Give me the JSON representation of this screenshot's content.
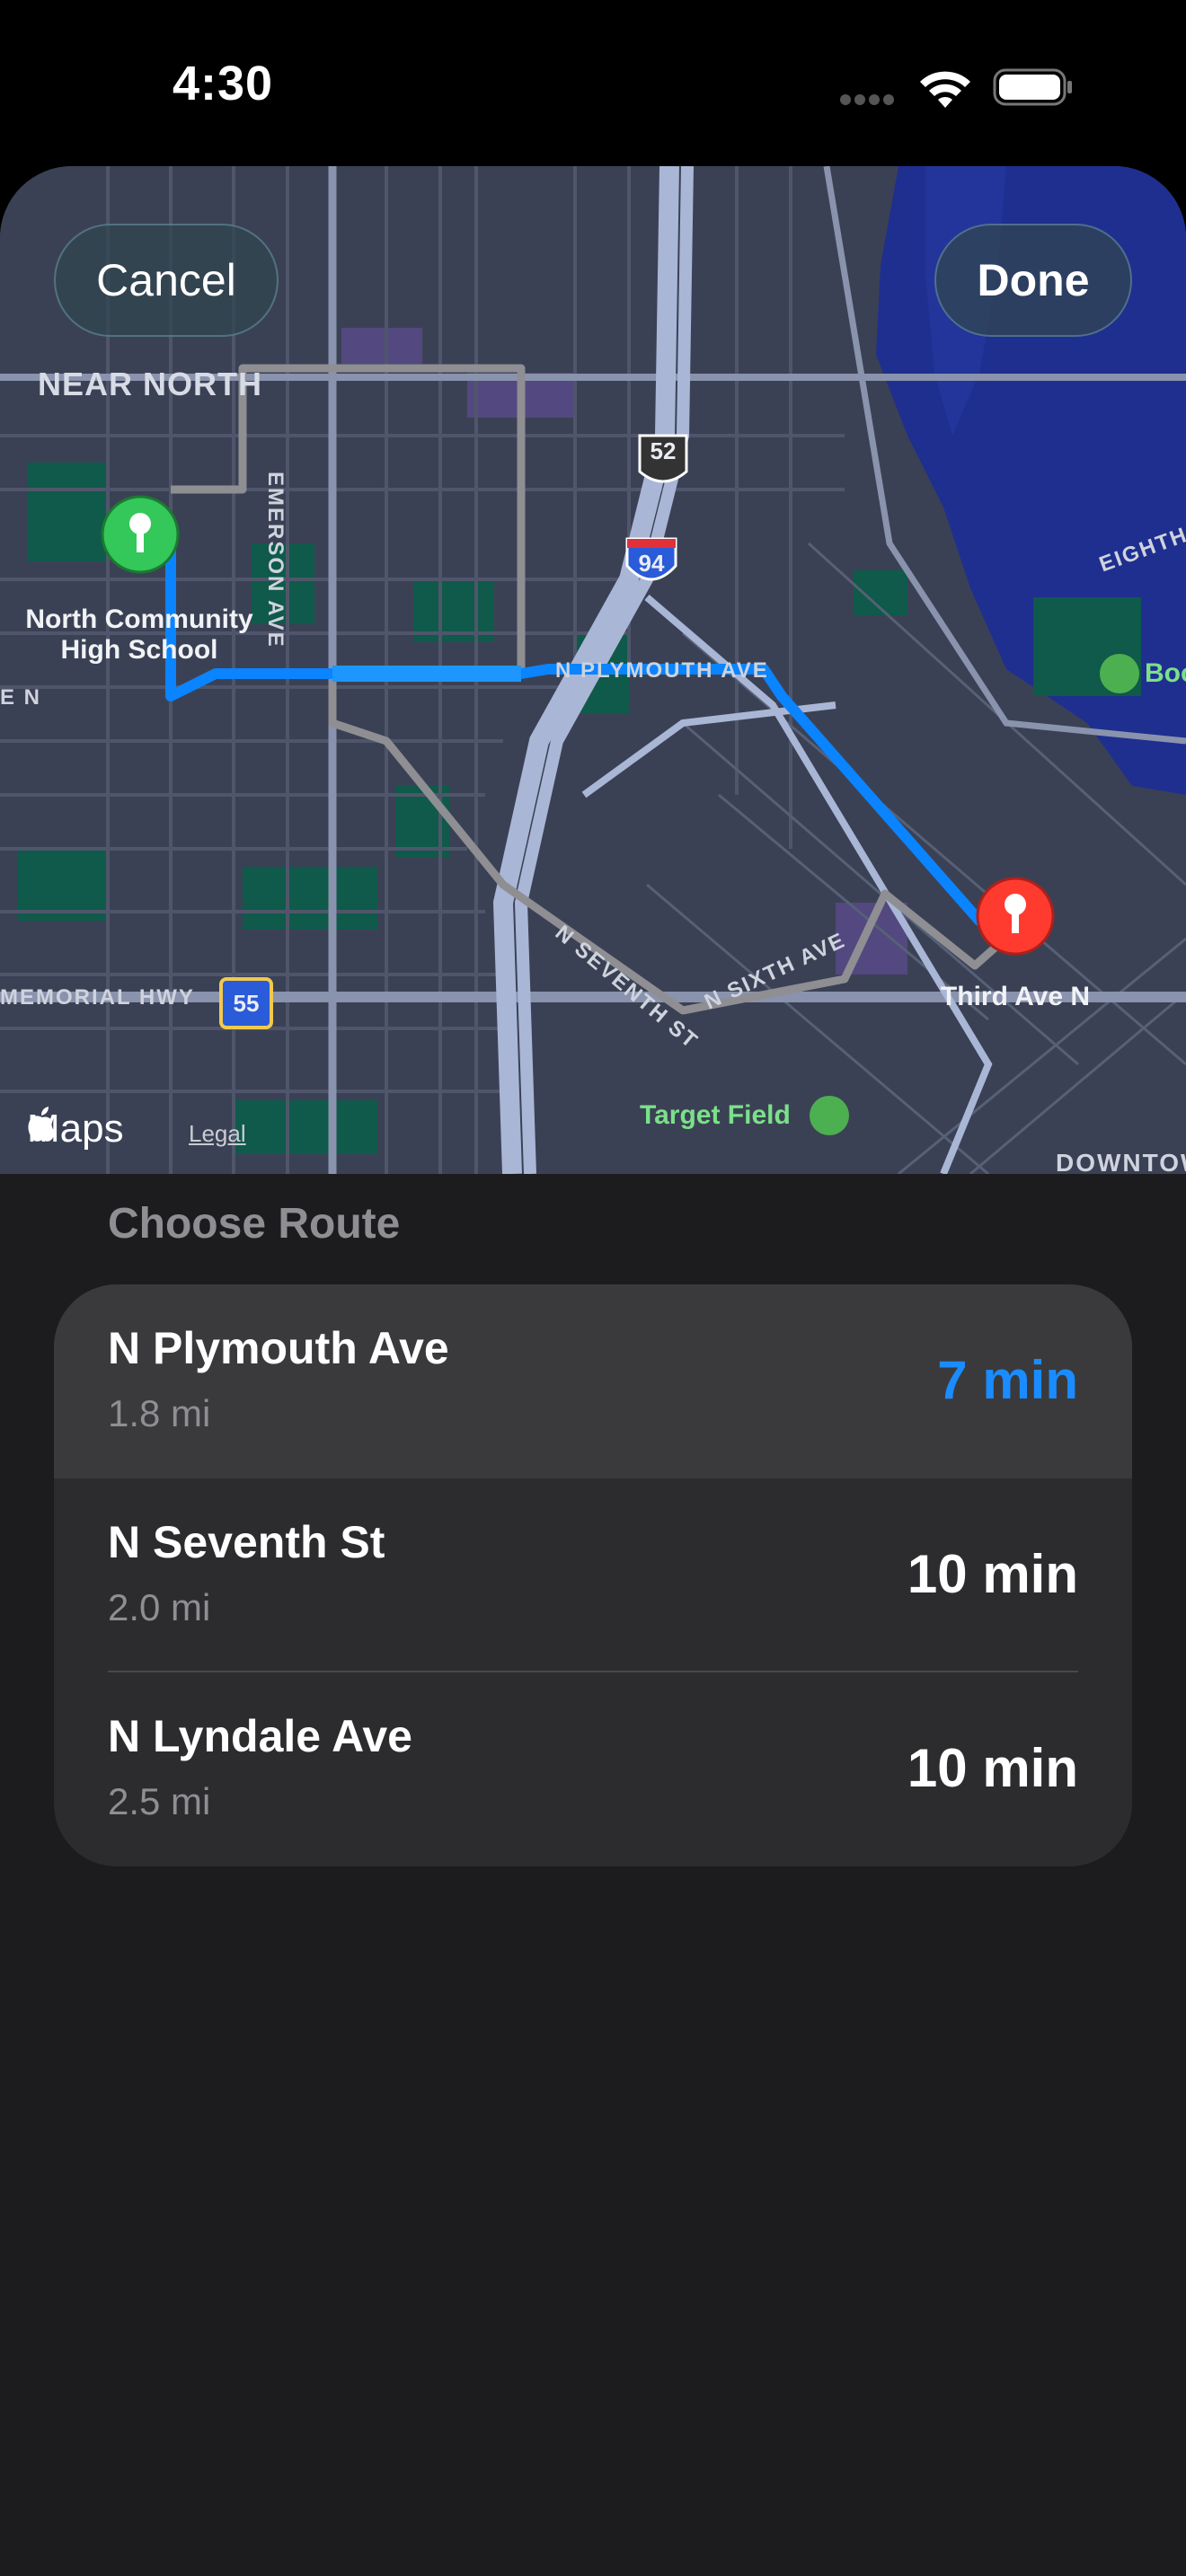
{
  "status_bar": {
    "time": "4:30"
  },
  "map": {
    "cancel_label": "Cancel",
    "done_label": "Done",
    "area_near_north": "NEAR NORTH",
    "street_emerson": "EMERSON AVE",
    "street_plymouth": "N PLYMOUTH AVE",
    "street_seventh": "N SEVENTH ST",
    "street_sixth": "N SIXTH AVE",
    "street_memorial": "MEMORIAL HWY",
    "street_eighth": "EIGHTH",
    "edge_label_left": "E N",
    "shield_52": "52",
    "shield_94": "94",
    "shield_55": "55",
    "start_poi": "North Community High School",
    "end_poi": "Third Ave N",
    "poi_target_field": "Target Field",
    "poi_boom": "Boo",
    "area_downtown": "DOWNTOW",
    "maps_brand": "Maps",
    "legal_label": "Legal"
  },
  "section_title": "Choose Route",
  "routes": [
    {
      "name": "N Plymouth Ave",
      "distance": "1.8 mi",
      "time": "7 min",
      "selected": true
    },
    {
      "name": "N Seventh St",
      "distance": "2.0 mi",
      "time": "10 min",
      "selected": false
    },
    {
      "name": "N Lyndale Ave",
      "distance": "2.5 mi",
      "time": "10 min",
      "selected": false
    }
  ],
  "colors": {
    "accent": "#1a8cff",
    "route_selected": "#0a84ff",
    "route_alt": "#8e8e93",
    "start_pin": "#34c759",
    "end_pin": "#ff3b30"
  }
}
